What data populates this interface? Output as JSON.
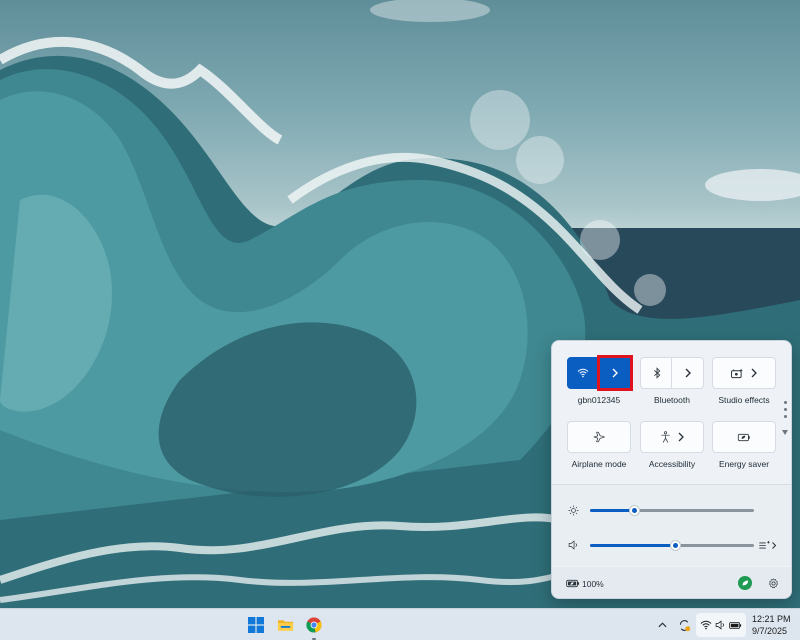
{
  "taskbar": {
    "apps": [
      {
        "name": "Start",
        "icon": "windows-logo-icon"
      },
      {
        "name": "File Explorer",
        "icon": "folder-icon"
      },
      {
        "name": "Google Chrome",
        "icon": "chrome-icon"
      }
    ],
    "clock": {
      "time": "12:21 PM",
      "date": "9/7/2025"
    }
  },
  "quick_settings": {
    "tiles": [
      {
        "label": "gbn012345",
        "icon": "wifi-icon",
        "state": "on",
        "has_expand": true
      },
      {
        "label": "Bluetooth",
        "icon": "bluetooth-icon",
        "state": "off",
        "has_expand": true
      },
      {
        "label": "Studio effects",
        "icon": "camera-effects-icon",
        "state": "off",
        "has_expand": true
      },
      {
        "label": "Airplane mode",
        "icon": "airplane-icon",
        "state": "off",
        "has_expand": false
      },
      {
        "label": "Accessibility",
        "icon": "accessibility-icon",
        "state": "off",
        "has_expand": true
      },
      {
        "label": "Energy saver",
        "icon": "energy-saver-icon",
        "state": "off",
        "has_expand": false
      }
    ],
    "brightness": {
      "value": 0.27,
      "icon": "sun-icon"
    },
    "volume": {
      "value": 0.52,
      "icon": "speaker-icon"
    },
    "battery": {
      "percent": "100%",
      "icon": "battery-icon"
    }
  },
  "colors": {
    "accent": "#0a5ec2",
    "highlight": "#e0141e"
  }
}
